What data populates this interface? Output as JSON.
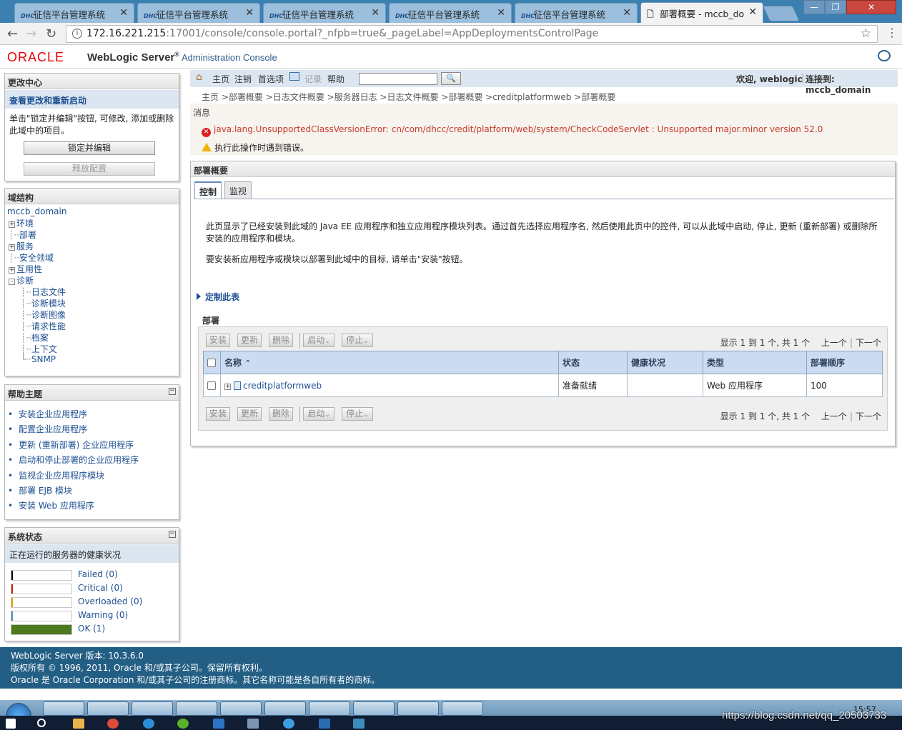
{
  "browser": {
    "tabs": [
      {
        "label": "征信平台管理系统"
      },
      {
        "label": "征信平台管理系统"
      },
      {
        "label": "征信平台管理系统"
      },
      {
        "label": "征信平台管理系统"
      },
      {
        "label": "征信平台管理系统"
      },
      {
        "label": "部署概要 - mccb_do"
      }
    ],
    "tab_icon_text": "DHC",
    "url_host": "172.16.221.215",
    "url_rest": ":17001/console/console.portal?_nfpb=true&_pageLabel=AppDeploymentsControlPage",
    "window_buttons": [
      "—",
      "❐",
      "✕"
    ]
  },
  "header": {
    "logo": "ORACLE",
    "product": "WebLogic Server",
    "reg": "®",
    "console": "Administration Console"
  },
  "change_center": {
    "title": "更改中心",
    "link": "查看更改和重新启动",
    "description": "单击\"锁定并编辑\"按钮, 可修改, 添加或删除此域中的项目。",
    "lock_button": "锁定并编辑",
    "release_button": "释放配置"
  },
  "domain_structure": {
    "title": "域结构",
    "root": "mccb_domain",
    "items": [
      {
        "label": "环境",
        "expander": "+"
      },
      {
        "label": "部署",
        "expander": ""
      },
      {
        "label": "服务",
        "expander": "+"
      },
      {
        "label": "安全领域",
        "expander": ""
      },
      {
        "label": "互用性",
        "expander": "+"
      },
      {
        "label": "诊断",
        "expander": "-"
      }
    ],
    "diag_children": [
      "日志文件",
      "诊断模块",
      "诊断图像",
      "请求性能",
      "档案",
      "上下文",
      "SNMP"
    ]
  },
  "help_topics": {
    "title": "帮助主题",
    "items": [
      "安装企业应用程序",
      "配置企业应用程序",
      "更新 (重新部署) 企业应用程序",
      "启动和停止部署的企业应用程序",
      "监视企业应用程序模块",
      "部署 EJB 模块",
      "安装 Web 应用程序"
    ]
  },
  "system_status": {
    "title": "系统状态",
    "subtitle": "正在运行的服务器的健康状况",
    "rows": [
      {
        "label": "Failed (0)",
        "count": 0,
        "color": "#000000"
      },
      {
        "label": "Critical (0)",
        "count": 0,
        "color": "#cc2200"
      },
      {
        "label": "Overloaded (0)",
        "count": 0,
        "color": "#e8a000"
      },
      {
        "label": "Warning (0)",
        "count": 0,
        "color": "#4a90c8"
      },
      {
        "label": "OK (1)",
        "count": 1,
        "color": "#4e7a1e"
      }
    ]
  },
  "topnav": {
    "home": "主页",
    "logout": "注销",
    "prefs": "首选项",
    "record": "记录",
    "help": "帮助",
    "welcome": "欢迎, weblogic",
    "connected": "连接到: mccb_domain"
  },
  "breadcrumbs": "主页 >部署概要 >日志文件概要 >服务器日志 >日志文件概要 >部署概要 >creditplatformweb >部署概要",
  "messages": {
    "title": "消息",
    "error": "java.lang.UnsupportedClassVersionError: cn/com/dhcc/credit/platform/web/system/CheckCodeServlet : Unsupported major.minor version 52.0",
    "warning": "执行此操作时遇到错误。"
  },
  "main": {
    "title": "部署概要",
    "tabs": [
      "控制",
      "监视"
    ],
    "intro1a": "此页显示了已经安装到此域的 Java EE 应用程序和独立应用程序模块列表。通过首先选择应用程序名, 然后使用此页中的控件, 可以从此域中启动, 停止, 更新 (重新部署) 或删除所",
    "intro1b": "安装的应用程序和模块。",
    "intro2": "要安装新应用程序或模块以部署到此域中的目标, 请单击\"安装\"按钮。",
    "customize": "定制此表",
    "deployments_title": "部署",
    "buttons": {
      "install": "安装",
      "update": "更新",
      "delete": "删除",
      "start": "启动",
      "stop": "停止"
    },
    "pager": {
      "text": "显示 1 到 1 个, 共 1 个",
      "prev": "上一个",
      "next": "下一个"
    },
    "columns": [
      "名称",
      "状态",
      "健康状况",
      "类型",
      "部署顺序"
    ],
    "rows": [
      {
        "name": "creditplatformweb",
        "state": "准备就绪",
        "health": "",
        "type": "Web 应用程序",
        "order": "100"
      }
    ]
  },
  "footer": {
    "line1": "WebLogic Server 版本: 10.3.6.0",
    "line2": "版权所有 © 1996, 2011, Oracle 和/或其子公司。保留所有权利。",
    "line3": "Oracle 是 Oracle Corporation 和/或其子公司的注册商标。其它名称可能是各自所有者的商标。"
  },
  "taskbar": {
    "clock": "15:57",
    "watermark": "https://blog.csdn.net/qq_20503733"
  }
}
